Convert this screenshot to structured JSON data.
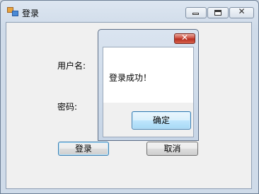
{
  "window": {
    "title": "登录",
    "title_icon": "app-icon",
    "controls": {
      "minimize_icon": "minimize-icon",
      "maximize_icon": "maximize-icon",
      "close_glyph": "✕"
    }
  },
  "form": {
    "username_label": "用户名:",
    "password_label": "密码:",
    "login_button": "登录",
    "cancel_button": "取消"
  },
  "dialog": {
    "close_glyph": "✕",
    "message": "登录成功！",
    "ok_button": "确定"
  },
  "colors": {
    "dialog_close_red": "#c9473a",
    "focus_border": "#3c7fb1"
  }
}
